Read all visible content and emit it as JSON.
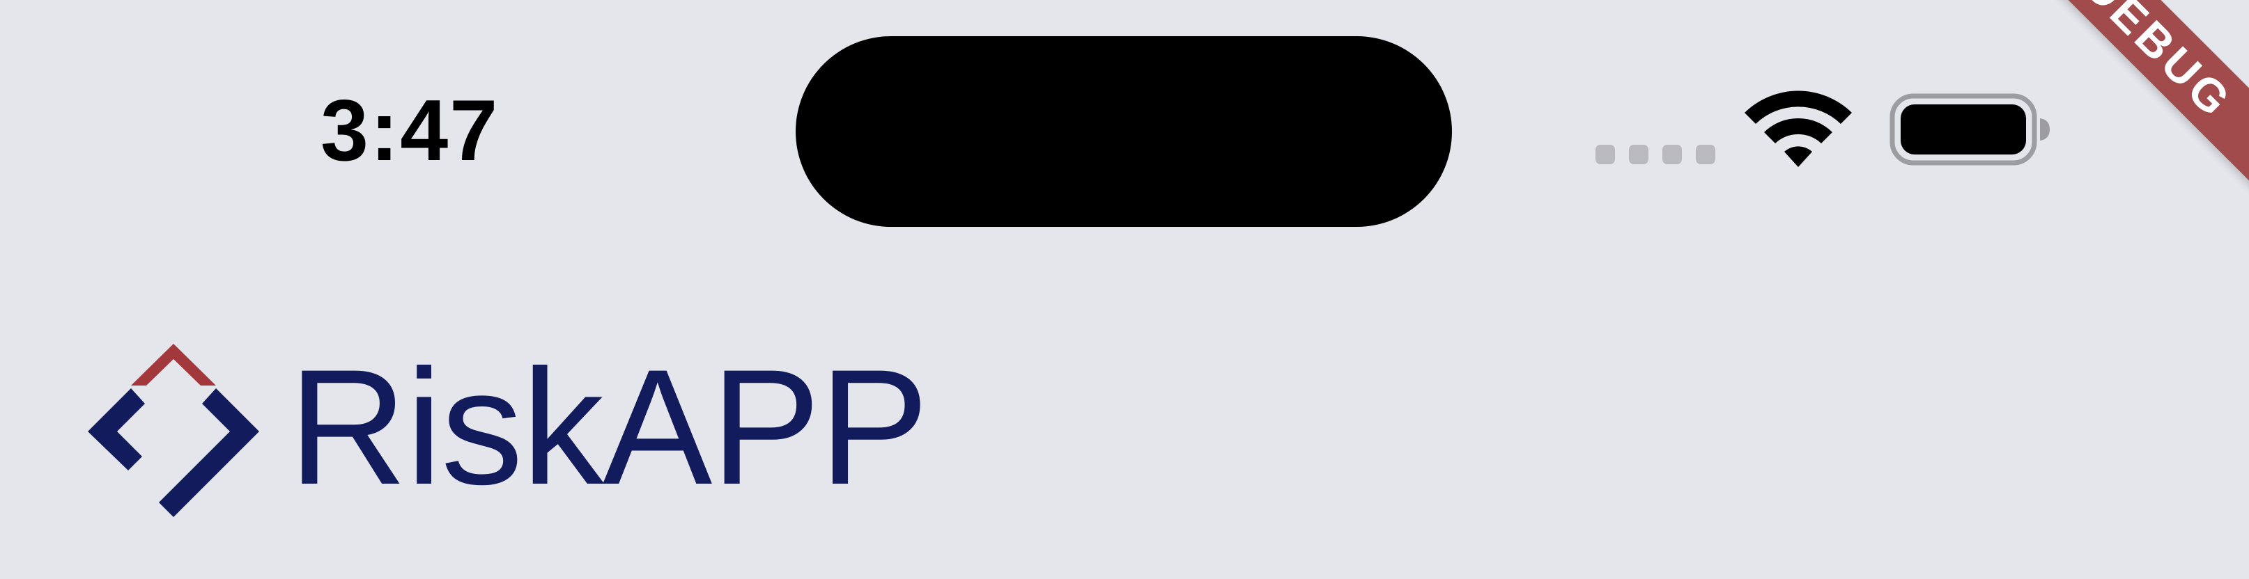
{
  "status_bar": {
    "time": "3:47",
    "signal_icon": "cellular-signal-icon",
    "wifi_icon": "wifi-icon",
    "battery_icon": "battery-icon"
  },
  "debug_banner": {
    "label": "DEBUG",
    "color": "#a24b4d"
  },
  "header": {
    "logo_icon": "riskapp-diamond-logo-icon",
    "brand_name": "RiskAPP",
    "brand_color": "#121c5d",
    "accent_color": "#a2383b"
  },
  "colors": {
    "background": "#e5e6ec"
  }
}
